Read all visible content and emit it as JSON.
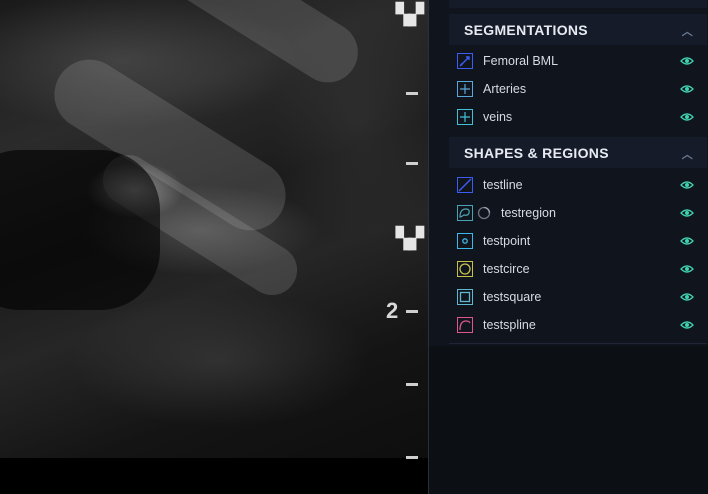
{
  "viewer": {
    "depth_label": "2"
  },
  "segmentations": {
    "title": "SEGMENTATIONS",
    "items": [
      {
        "label": "Femoral BML",
        "icon": "pencil-segmentation-icon",
        "color": "#3d5bf5"
      },
      {
        "label": "Arteries",
        "icon": "crosshair-segmentation-icon",
        "color": "#5aa7d8"
      },
      {
        "label": "veins",
        "icon": "crosshair-segmentation-icon",
        "color": "#3fc1d6"
      }
    ]
  },
  "shapes": {
    "title": "SHAPES & REGIONS",
    "items": [
      {
        "label": "testline",
        "icon": "line-icon",
        "color": "#3d5bf5"
      },
      {
        "label": "testregion",
        "icon": "region-icon",
        "color": "#4aa3b4"
      },
      {
        "label": "testpoint",
        "icon": "point-icon",
        "color": "#3fb6e8"
      },
      {
        "label": "testcirce",
        "icon": "circle-icon",
        "color": "#c9c24a"
      },
      {
        "label": "testsquare",
        "icon": "square-icon",
        "color": "#5fb8cf"
      },
      {
        "label": "testspline",
        "icon": "spline-icon",
        "color": "#e0558a"
      }
    ]
  },
  "colors": {
    "eye": "#3fd1b0",
    "panel_bg": "#10141c",
    "header_bg": "#151b29"
  }
}
